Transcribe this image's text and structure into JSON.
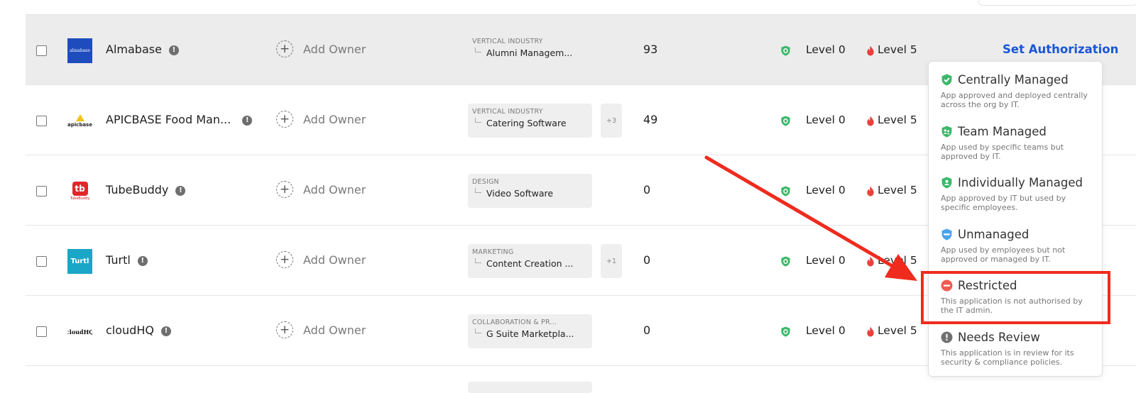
{
  "owner_label": "Add Owner",
  "rows": [
    {
      "name": "Almabase",
      "logo_text": "almabase",
      "category_title": "VERTICAL INDUSTRY",
      "category_value": "Alumni Managem...",
      "more": "",
      "count": "93",
      "level": "Level 0",
      "risk_level": "Level 5",
      "action": "Set Authorization"
    },
    {
      "name": "APICBASE Food Man...",
      "logo_text": "apicbase",
      "category_title": "VERTICAL INDUSTRY",
      "category_value": "Catering Software",
      "more": "+3",
      "count": "49",
      "level": "Level 0",
      "risk_level": "Level 5"
    },
    {
      "name": "TubeBuddy",
      "logo_text": "TubeBuddy",
      "category_title": "DESIGN",
      "category_value": "Video Software",
      "more": "",
      "count": "0",
      "level": "Level 0",
      "risk_level": "Level 5"
    },
    {
      "name": "Turtl",
      "logo_text": "Turtl",
      "category_title": "MARKETING",
      "category_value": "Content Creation ...",
      "more": "+1",
      "count": "0",
      "level": "Level 0",
      "risk_level": "Level 5"
    },
    {
      "name": "cloudHQ",
      "logo_text": "cloudHQ",
      "category_title": "COLLABORATION & PR...",
      "category_value": "G Suite Marketpla...",
      "more": "",
      "count": "0",
      "level": "Level 0",
      "risk_level": "Level 5"
    }
  ],
  "authorization_menu": [
    {
      "title": "Centrally Managed",
      "desc": "App approved and deployed centrally across the org by IT.",
      "icon": "shield-check-icon",
      "color": "#3db86a"
    },
    {
      "title": "Team Managed",
      "desc": "App used by specific teams but approved by IT.",
      "icon": "shield-team-icon",
      "color": "#3db86a"
    },
    {
      "title": "Individually Managed",
      "desc": "App approved by IT but used by specific employees.",
      "icon": "shield-user-icon",
      "color": "#3db86a"
    },
    {
      "title": "Unmanaged",
      "desc": "App used by employees but not approved or managed by IT.",
      "icon": "shield-minus-icon",
      "color": "#4aa3f0"
    },
    {
      "title": "Restricted",
      "desc": "This application is not authorised by the IT admin.",
      "icon": "no-entry-icon",
      "color": "#ef5b50"
    },
    {
      "title": "Needs Review",
      "desc": "This application is in review for its security & compliance policies.",
      "icon": "exclamation-icon",
      "color": "#707070"
    }
  ],
  "colors": {
    "accent": "#1a57d6",
    "annotation_red": "#ef2b1e",
    "shield_green": "#3db86a",
    "flame_red": "#e8413a"
  }
}
